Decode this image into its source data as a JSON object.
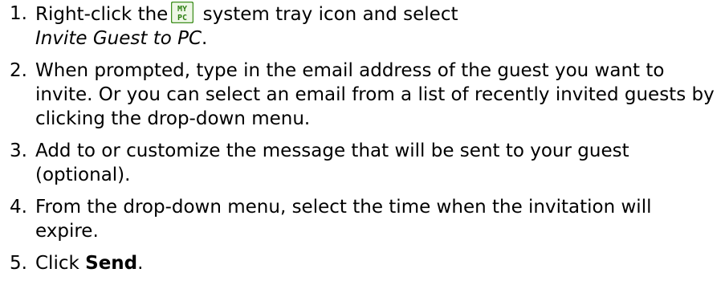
{
  "steps": [
    {
      "number": "1.",
      "text_before": "Right-click the",
      "icon": "mypc-tray-icon",
      "icon_text_top": "MY",
      "icon_text_bottom": "PC",
      "text_after": " system tray icon and select",
      "menu_item": "Invite Guest to PC",
      "text_end": "."
    },
    {
      "number": "2.",
      "text": "When prompted, type in the email address of the guest you want to invite. Or you can select an email from a list of recently invited guests by clicking the drop-down menu."
    },
    {
      "number": "3.",
      "text": "Add to or customize the message that will be sent to your guest (optional)."
    },
    {
      "number": "4.",
      "text": "From the drop-down menu, select the time when the invitation will expire."
    },
    {
      "number": "5.",
      "text_before": "Click ",
      "button_label": "Send",
      "text_end": "."
    }
  ],
  "colors": {
    "text": "#000000",
    "icon_border": "#3f8f1f",
    "icon_fill": "#eef7e6",
    "icon_text": "#2d7f12"
  }
}
